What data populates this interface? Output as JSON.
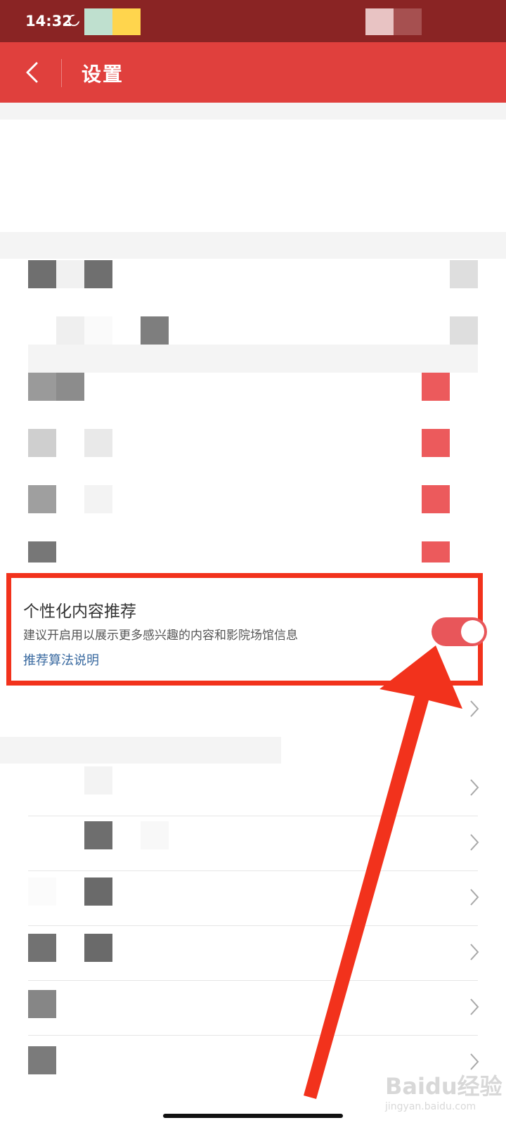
{
  "status_bar": {
    "time": "14:32"
  },
  "header": {
    "title": "设置",
    "back_icon": "chevron-left-icon"
  },
  "personalization": {
    "title": "个性化内容推荐",
    "description": "建议开启用以展示更多感兴趣的内容和影院场馆信息",
    "link": "推荐算法说明",
    "toggle_on": true,
    "toggle_color": "#e8565a"
  },
  "annotation": {
    "color": "#f2321c"
  },
  "watermark": {
    "brand": "Baidu经验",
    "sub": "jingyan.baidu.com"
  },
  "colors": {
    "accent": "#e0403d",
    "status_bar": "#8a2424"
  }
}
